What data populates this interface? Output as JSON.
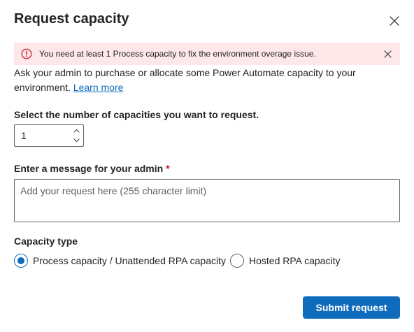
{
  "dialog": {
    "title": "Request capacity",
    "close_icon": "close-icon"
  },
  "banner": {
    "text": "You need at least 1 Process capacity to fix the environment overage issue.",
    "icon": "error-circle-icon",
    "close_icon": "close-icon",
    "background": "#fde7e9",
    "icon_color": "#c50f1f"
  },
  "description": {
    "text": "Ask your admin to purchase or allocate some Power Automate capacity to your environment.",
    "link": "Learn more"
  },
  "capacity_count": {
    "label": "Select the number of capacities you want to request.",
    "value": "1",
    "up_icon": "chevron-up-icon",
    "down_icon": "chevron-down-icon"
  },
  "message": {
    "label": "Enter a message for your admin",
    "required_marker": "*",
    "placeholder": "Add your request here (255 character limit)",
    "value": ""
  },
  "capacity_type": {
    "label": "Capacity type",
    "options": [
      {
        "label": "Process capacity / Unattended RPA capacity",
        "checked": true
      },
      {
        "label": "Hosted RPA capacity",
        "checked": false
      }
    ]
  },
  "actions": {
    "submit_label": "Submit request"
  },
  "colors": {
    "accent": "#0f6cbd",
    "error": "#c50f1f"
  }
}
